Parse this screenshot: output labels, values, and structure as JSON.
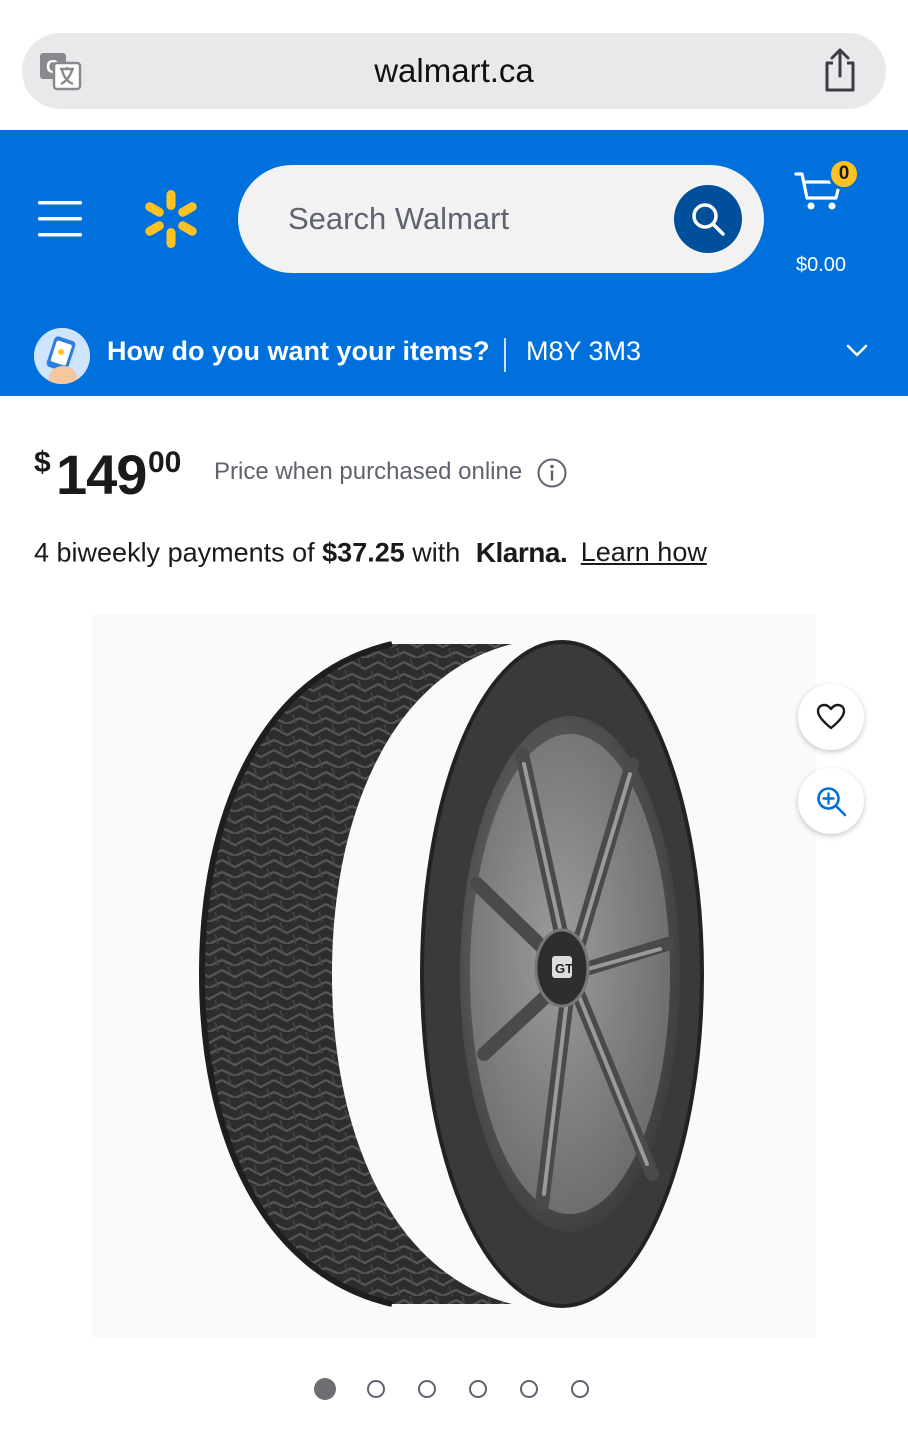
{
  "browser": {
    "url": "walmart.ca"
  },
  "header": {
    "search": {
      "placeholder": "Search Walmart"
    },
    "cart": {
      "count": "0",
      "total": "$0.00"
    },
    "delivery": {
      "question": "How do you want your items?",
      "postal_code": "M8Y 3M3"
    }
  },
  "product": {
    "price": {
      "currency": "$",
      "dollars": "149",
      "cents": "00"
    },
    "price_note": "Price when purchased online",
    "klarna": {
      "prefix": "4 biweekly payments of",
      "amount": "$37.25",
      "with": "with",
      "brand": "Klarna.",
      "link": "Learn how"
    },
    "image_count": 6,
    "active_image_index": 0
  },
  "colors": {
    "brand_blue": "#0071dc",
    "search_button": "#004f9a",
    "spark_yellow": "#ffc220"
  },
  "icons": [
    "translate-icon",
    "share-icon",
    "menu-icon",
    "walmart-spark-icon",
    "search-icon",
    "cart-icon",
    "chevron-down-icon",
    "info-icon",
    "heart-icon",
    "zoom-in-icon"
  ]
}
